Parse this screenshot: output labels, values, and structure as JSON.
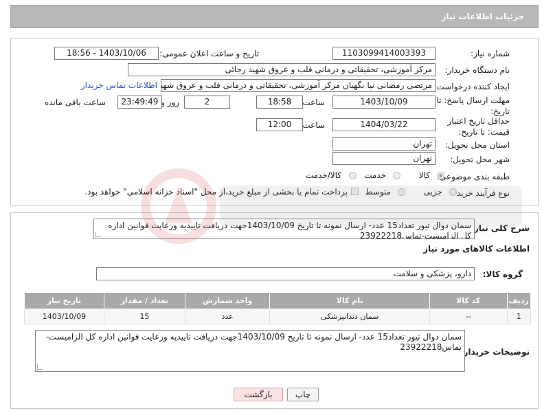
{
  "header": {
    "title": "جزئیات اطلاعات نیاز"
  },
  "form": {
    "need_number_label": "شماره نیاز:",
    "need_number": "1103099414003393",
    "announce_label": "تاریخ و ساعت اعلان عمومی:",
    "announce_value": "1403/10/06 - 18:56",
    "buyer_org_label": "نام دستگاه خریدار:",
    "buyer_org": "مرکز آموزشی، تحقیقاتی و درمانی قلب و عروق شهید رجائی",
    "creator_label": "ایجاد کننده درخواست:",
    "creator": "مرتضی رمضانی نیا نگهبان مرکز آموزشی، تحقیقاتی و درمانی قلب و عروق شهید",
    "buyer_contact_link": "اطلاعات تماس خریدار",
    "deadline_label": "مهلت ارسال پاسخ: تا تاریخ:",
    "deadline_date": "1403/10/09",
    "time_label": "ساعت",
    "deadline_time": "18:58",
    "days_value": "2",
    "days_label": "روز و",
    "remaining_time": "23:49:49",
    "remaining_label": "ساعت باقی مانده",
    "validity_label": "حداقل تاریخ اعتبار قیمت: تا تاریخ:",
    "validity_date": "1404/03/22",
    "validity_time_label": "ساعت",
    "validity_time": "12:00",
    "province_label": "استان محل تحویل:",
    "province": "تهران",
    "city_label": "شهر محل تحویل:",
    "city": "تهران",
    "category_label": "طبقه بندی موضوعی:",
    "category_options": [
      "کالا",
      "خدمت",
      "کالا/خدمت"
    ],
    "process_label": "نوع فرآیند خرید :",
    "process_options": [
      "جزیی",
      "متوسط"
    ],
    "payment_note": "پرداخت تمام یا بخشی از مبلغ خرید،از محل \"اسناد خزانه اسلامی\" خواهد بود."
  },
  "description": {
    "label": "شرح کلی نیاز:",
    "text": "سمان دوال تیور تعداد15 عدد- ارسال نمونه تا تاریخ 1403/10/09جهت دریافت تاییدیه ورعایت قوانین اداره کل الزامیست-تماس23922218"
  },
  "goods": {
    "section_title": "اطلاعات کالاهای مورد نیاز",
    "group_label": "گروه کالا:",
    "group_value": "دارو، پزشکی و سلامت",
    "columns": [
      "ردیف",
      "کد کالا",
      "نام کالا",
      "واحد شمارش",
      "تعداد / مقدار",
      "تاریخ نیاز"
    ],
    "rows": [
      [
        "1",
        "--",
        "سمان دندانپزشکی",
        "عدد",
        "15",
        "1403/10/09"
      ]
    ]
  },
  "buyer_notes": {
    "label": "توضیحات خریدار:",
    "text": "سمان دوال تیور تعداد15 عدد- ارسال نمونه تا تاریخ 1403/10/09جهت دریافت تاییدیه ورعایت قوانین اداره کل الزامیست-تماس23922218"
  },
  "buttons": {
    "print": "چاپ",
    "back": "بازگشت"
  },
  "colors": {
    "header_bg": "#b8b8b8",
    "table_header_bg": "#a9a9a9",
    "link": "#2a4fb8",
    "back_button_bg": "#fde3e3"
  }
}
